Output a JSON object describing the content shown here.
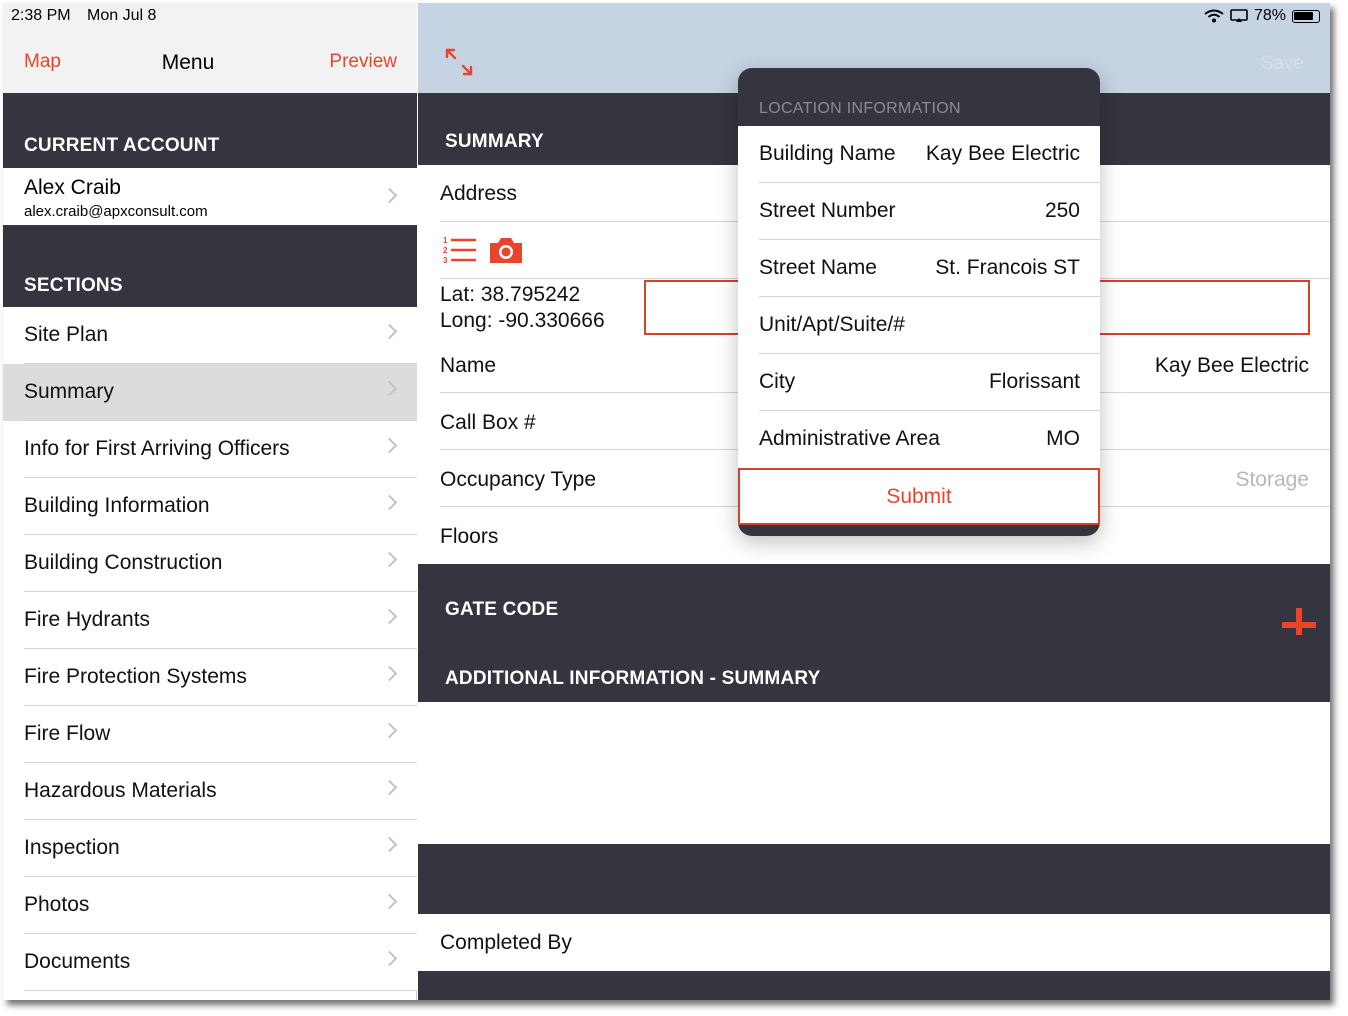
{
  "status_bar": {
    "time": "2:38 PM",
    "date": "Mon Jul 8",
    "battery": "78%"
  },
  "sidebar": {
    "nav": {
      "left": "Map",
      "title": "Menu",
      "right": "Preview"
    },
    "account_header": "CURRENT ACCOUNT",
    "account": {
      "name": "Alex Craib",
      "email": "alex.craib@apxconsult.com"
    },
    "sections_header": "SECTIONS",
    "selected": "Summary",
    "items": [
      {
        "label": "Site Plan"
      },
      {
        "label": "Summary"
      },
      {
        "label": "Info for First Arriving Officers"
      },
      {
        "label": "Building Information"
      },
      {
        "label": "Building Construction"
      },
      {
        "label": "Fire Hydrants"
      },
      {
        "label": "Fire Protection Systems"
      },
      {
        "label": "Fire Flow"
      },
      {
        "label": "Hazardous Materials"
      },
      {
        "label": "Inspection"
      },
      {
        "label": "Photos"
      },
      {
        "label": "Documents"
      }
    ]
  },
  "main": {
    "save_label": "Save",
    "summary_header": "SUMMARY",
    "address_label": "Address",
    "lat": "Lat: 38.795242",
    "long": "Long: -90.330666",
    "name_label": "Name",
    "name_value": "Kay Bee Electric",
    "callbox_label": "Call Box #",
    "occupancy_label": "Occupancy Type",
    "occupancy_placeholder": "Storage",
    "floors_label": "Floors",
    "gate_code_header": "GATE CODE",
    "additional_header": "ADDITIONAL INFORMATION - SUMMARY",
    "completed_by_label": "Completed By",
    "icons": {
      "expand": "expand-arrows-icon",
      "list": "numbered-list-icon",
      "camera": "camera-icon",
      "add": "plus-icon"
    },
    "accent_color": "#e8452c"
  },
  "popover": {
    "title": "LOCATION INFORMATION",
    "fields": [
      {
        "label": "Building Name",
        "value": "Kay Bee Electric"
      },
      {
        "label": "Street Number",
        "value": "250"
      },
      {
        "label": "Street Name",
        "value": "St. Francois ST"
      },
      {
        "label": "Unit/Apt/Suite/#",
        "value": ""
      },
      {
        "label": "City",
        "value": "Florissant"
      },
      {
        "label": "Administrative Area",
        "value": "MO"
      }
    ],
    "submit_label": "Submit"
  }
}
